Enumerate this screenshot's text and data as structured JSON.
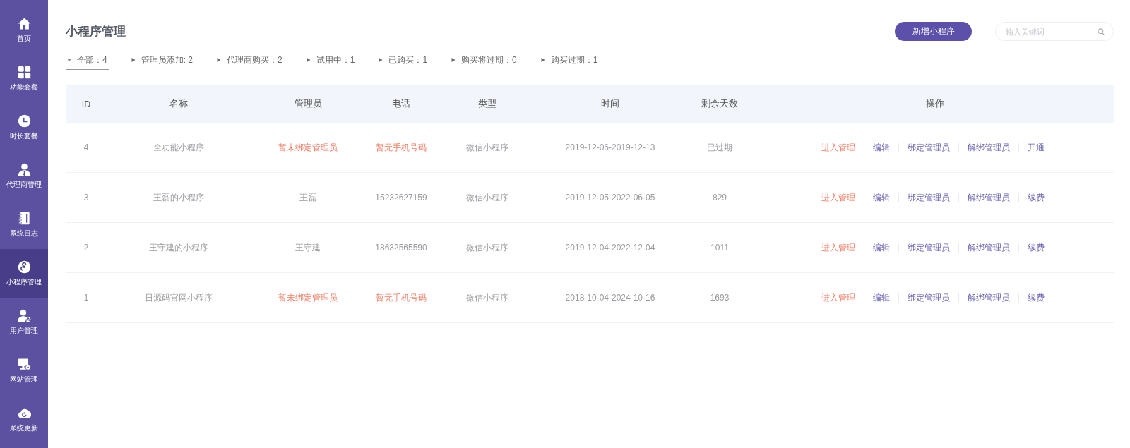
{
  "sidebar": {
    "items": [
      {
        "label": "首页",
        "selected": false
      },
      {
        "label": "功能套餐",
        "selected": false
      },
      {
        "label": "时长套餐",
        "selected": false
      },
      {
        "label": "代理商管理",
        "selected": false
      },
      {
        "label": "系统日志",
        "selected": false
      },
      {
        "label": "小程序管理",
        "selected": true
      },
      {
        "label": "用户管理",
        "selected": false
      },
      {
        "label": "网站管理",
        "selected": false
      },
      {
        "label": "系统更新",
        "selected": false
      }
    ]
  },
  "page": {
    "title": "小程序管理",
    "add_button": "新增小程序",
    "search": {
      "placeholder": "输入关键词"
    }
  },
  "filters": [
    {
      "label": "全部：4",
      "selected": true
    },
    {
      "label": "管理员添加: 2",
      "selected": false
    },
    {
      "label": "代理商购买：2",
      "selected": false
    },
    {
      "label": "试用中：1",
      "selected": false
    },
    {
      "label": "已购买：1",
      "selected": false
    },
    {
      "label": "购买将过期：0",
      "selected": false
    },
    {
      "label": "购买过期：1",
      "selected": false
    }
  ],
  "table": {
    "columns": [
      "ID",
      "名称",
      "管理员",
      "电话",
      "类型",
      "时间",
      "剩余天数",
      "操作"
    ],
    "rows": [
      {
        "id": "4",
        "name": "全功能小程序",
        "admin": {
          "text": "暂未绑定管理员",
          "missing": true
        },
        "phone": {
          "text": "暂无手机号码",
          "missing": true
        },
        "type": "微信小程序",
        "period": "2019-12-06-2019-12-13",
        "days_left": "已过期",
        "actions": [
          {
            "label": "进入管理",
            "kind": "primary"
          },
          {
            "label": "编辑",
            "kind": "link"
          },
          {
            "label": "绑定管理员",
            "kind": "link"
          },
          {
            "label": "解绑管理员",
            "kind": "link"
          },
          {
            "label": "开通",
            "kind": "link"
          }
        ]
      },
      {
        "id": "3",
        "name": "王磊的小程序",
        "admin": {
          "text": "王磊",
          "missing": false
        },
        "phone": {
          "text": "15232627159",
          "missing": false
        },
        "type": "微信小程序",
        "period": "2019-12-05-2022-06-05",
        "days_left": "829",
        "actions": [
          {
            "label": "进入管理",
            "kind": "primary"
          },
          {
            "label": "编辑",
            "kind": "link"
          },
          {
            "label": "绑定管理员",
            "kind": "link"
          },
          {
            "label": "解绑管理员",
            "kind": "link"
          },
          {
            "label": "续费",
            "kind": "link"
          }
        ]
      },
      {
        "id": "2",
        "name": "王守建的小程序",
        "admin": {
          "text": "王守建",
          "missing": false
        },
        "phone": {
          "text": "18632565590",
          "missing": false
        },
        "type": "微信小程序",
        "period": "2019-12-04-2022-12-04",
        "days_left": "1011",
        "actions": [
          {
            "label": "进入管理",
            "kind": "primary"
          },
          {
            "label": "编辑",
            "kind": "link"
          },
          {
            "label": "绑定管理员",
            "kind": "link"
          },
          {
            "label": "解绑管理员",
            "kind": "link"
          },
          {
            "label": "续费",
            "kind": "link"
          }
        ]
      },
      {
        "id": "1",
        "name": "日源码官网小程序",
        "admin": {
          "text": "暂未绑定管理员",
          "missing": true
        },
        "phone": {
          "text": "暂无手机号码",
          "missing": true
        },
        "type": "微信小程序",
        "period": "2018-10-04-2024-10-16",
        "days_left": "1693",
        "actions": [
          {
            "label": "进入管理",
            "kind": "primary"
          },
          {
            "label": "编辑",
            "kind": "link"
          },
          {
            "label": "绑定管理员",
            "kind": "link"
          },
          {
            "label": "解绑管理员",
            "kind": "link"
          },
          {
            "label": "续费",
            "kind": "link"
          }
        ]
      }
    ]
  }
}
